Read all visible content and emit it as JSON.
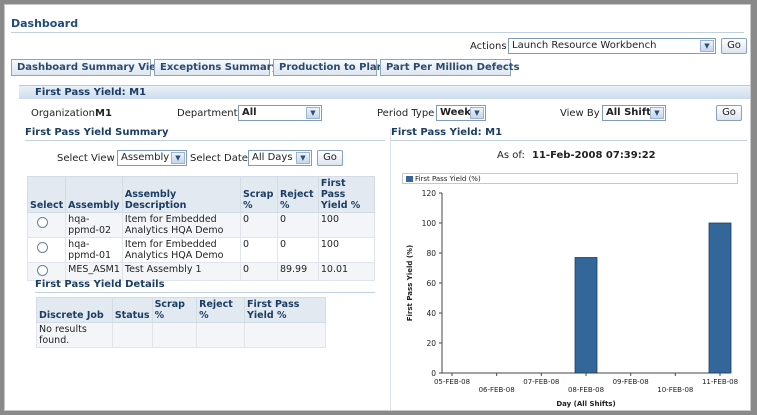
{
  "page": {
    "title": "Dashboard"
  },
  "actions": {
    "label": "Actions",
    "selected": "Launch Resource Workbench",
    "go_label": "Go"
  },
  "tabs": [
    {
      "label": "Dashboard Summary View"
    },
    {
      "label": "Exceptions Summary"
    },
    {
      "label": "Production to Plan"
    },
    {
      "label": "Part Per Million Defects"
    }
  ],
  "band": {
    "title": "First Pass Yield: M1"
  },
  "filters": {
    "organization_label": "Organization",
    "organization_value": "M1",
    "department_label": "Department",
    "department_value": "All",
    "period_label": "Period Type",
    "period_value": "Week",
    "viewby_label": "View By",
    "viewby_value": "All Shifts",
    "go_label": "Go"
  },
  "summary": {
    "title": "First Pass Yield Summary",
    "select_view_label": "Select View",
    "select_view_value": "Assembly",
    "select_date_label": "Select Date",
    "select_date_value": "All Days",
    "go_label": "Go",
    "columns": [
      "Select",
      "Assembly",
      "Assembly Description",
      "Scrap %",
      "Reject %",
      "First Pass Yield %"
    ],
    "rows": [
      {
        "assembly": "hqa-ppmd-02",
        "description": "Item for Embedded Analytics HQA Demo",
        "scrap": "0",
        "reject": "0",
        "fpy": "100"
      },
      {
        "assembly": "hqa-ppmd-01",
        "description": "Item for Embedded Analytics HQA Demo",
        "scrap": "0",
        "reject": "0",
        "fpy": "100"
      },
      {
        "assembly": "MES_ASM1",
        "description": "Test Assembly 1",
        "scrap": "0",
        "reject": "89.99",
        "fpy": "10.01"
      }
    ]
  },
  "details": {
    "title": "First Pass Yield Details",
    "columns": [
      "Discrete Job",
      "Status",
      "Scrap %",
      "Reject %",
      "First Pass Yield %"
    ],
    "empty_text": "No results found."
  },
  "chart_panel": {
    "title": "First Pass Yield: M1",
    "asof_label": "As of:",
    "asof_value": "11-Feb-2008 07:39:22"
  },
  "colors": {
    "bar": "#336699",
    "accent": "#1b3d63"
  },
  "chart_data": {
    "type": "bar",
    "legend": "First Pass Yield (%)",
    "categories": [
      "05-FEB-08",
      "06-FEB-08",
      "07-FEB-08",
      "08-FEB-08",
      "09-FEB-08",
      "10-FEB-08",
      "11-FEB-08"
    ],
    "series": [
      {
        "name": "First Pass Yield (%)",
        "values": [
          0,
          0,
          0,
          77,
          0,
          0,
          100
        ]
      }
    ],
    "xlabel": "Day (All Shifts)",
    "ylabel": "First Pass Yield (%)",
    "ylim": [
      0,
      120
    ],
    "yticks": [
      0,
      20,
      40,
      60,
      80,
      100,
      120
    ],
    "grid": false,
    "legend_position": "top"
  }
}
